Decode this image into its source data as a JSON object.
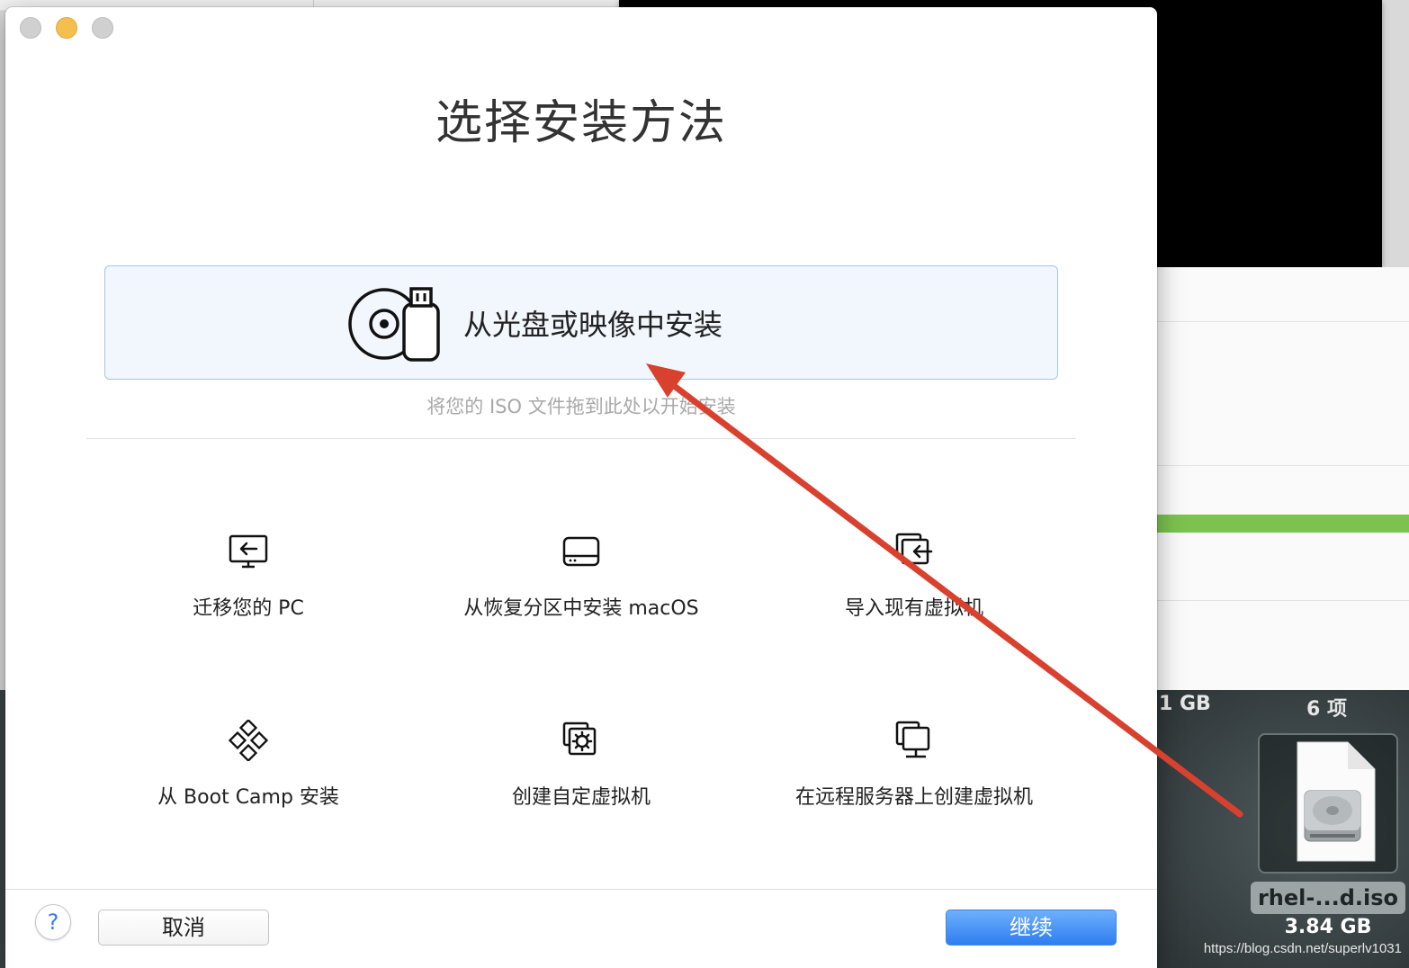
{
  "dialog": {
    "title": "选择安装方法",
    "primary_option": {
      "label": "从光盘或映像中安装",
      "icon": "disc-usb-icon"
    },
    "drop_hint": "将您的 ISO 文件拖到此处以开始安装",
    "options": [
      {
        "label": "迁移您的 PC",
        "icon": "migrate-pc-icon"
      },
      {
        "label": "从恢复分区中安装 macOS",
        "icon": "recovery-drive-icon"
      },
      {
        "label": "导入现有虚拟机",
        "icon": "import-vm-icon"
      },
      {
        "label": "从 Boot Camp 安装",
        "icon": "bootcamp-icon"
      },
      {
        "label": "创建自定虚拟机",
        "icon": "custom-vm-icon"
      },
      {
        "label": "在远程服务器上创建虚拟机",
        "icon": "remote-server-icon"
      }
    ],
    "help_label": "?",
    "cancel_label": "取消",
    "continue_label": "继续"
  },
  "finder": {
    "size_summary": "1 GB",
    "item_count": "6 项",
    "file_name": "rhel-...d.iso",
    "file_size": "3.84 GB",
    "file_icon": "disk-image-file-icon"
  },
  "watermark": "https://blog.csdn.net/superlv1031",
  "colors": {
    "accent": "#2f7ef0",
    "selected_bg": "#f2f7fd",
    "selected_border": "#a9c3e6",
    "annotation_arrow": "#d9412f",
    "progress_green": "#7bc24f"
  }
}
